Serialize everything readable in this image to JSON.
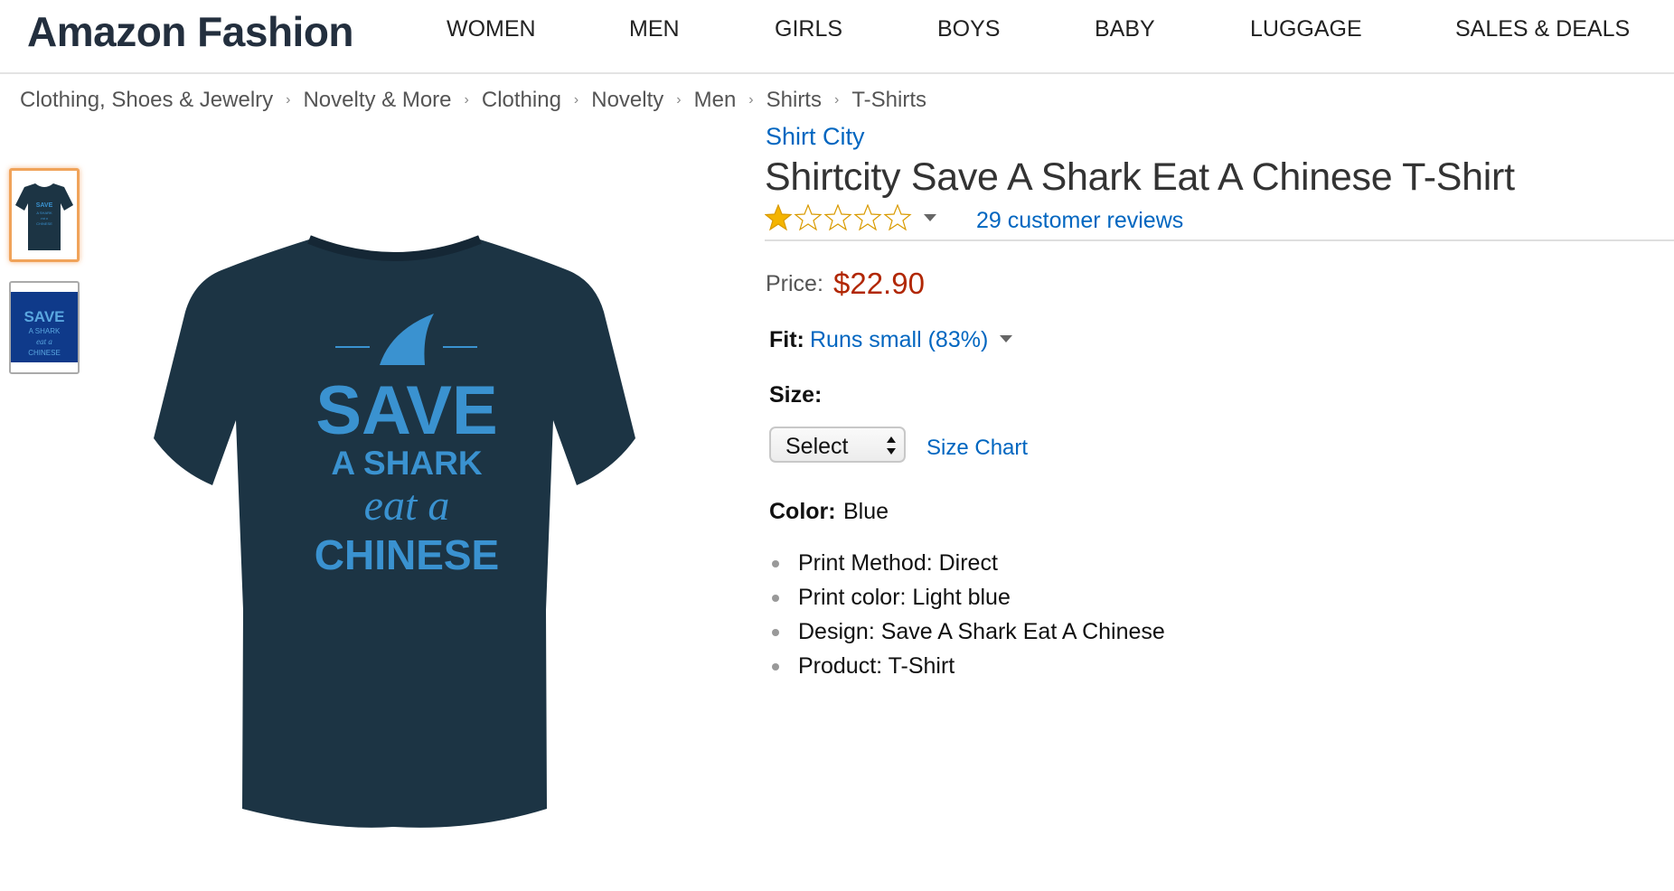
{
  "header": {
    "logo": "Amazon Fashion",
    "nav": [
      "WOMEN",
      "MEN",
      "GIRLS",
      "BOYS",
      "BABY",
      "LUGGAGE",
      "SALES & DEALS"
    ]
  },
  "breadcrumb": [
    "Clothing, Shoes & Jewelry",
    "Novelty & More",
    "Clothing",
    "Novelty",
    "Men",
    "Shirts",
    "T-Shirts"
  ],
  "breadcrumb_separator": "›",
  "product": {
    "brand": "Shirt City",
    "title": "Shirtcity Save A Shark Eat A Chinese T-Shirt",
    "rating": 1,
    "rating_max": 5,
    "reviews": "29 customer reviews",
    "price_label": "Price:",
    "price": "$22.90",
    "fit_label": "Fit:",
    "fit_value": "Runs small (83%)",
    "size_label": "Size:",
    "size_select": "Select",
    "size_chart": "Size Chart",
    "color_label": "Color:",
    "color_value": "Blue",
    "bullets": [
      "Print Method: Direct",
      "Print color: Light blue",
      "Design: Save A Shark Eat A Chinese",
      "Product: T-Shirt"
    ],
    "shirt_print": {
      "line1": "SAVE",
      "line2": "A SHARK",
      "line3": "eat a",
      "line4": "CHINESE"
    }
  },
  "colors": {
    "accent_link": "#0066c0",
    "price": "#b12704",
    "shirt": "#1c3444",
    "print": "#3a92d0",
    "star": "#f4b400",
    "thumb_selected_border": "#f0a35a"
  },
  "icons": {
    "rating": "star-rating-icon",
    "dropdown": "caret-down-icon",
    "select_arrows": "select-arrows-icon",
    "shark_fin": "shark-fin-icon"
  }
}
